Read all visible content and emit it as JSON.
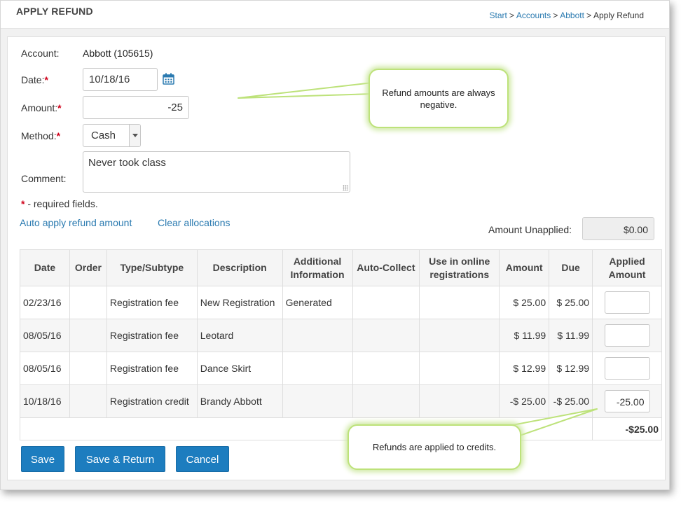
{
  "header": {
    "title": "APPLY REFUND",
    "breadcrumb": [
      "Start",
      "Accounts",
      "Abbott",
      "Apply Refund"
    ],
    "breadcrumb_sep": ">"
  },
  "form": {
    "account_label": "Account:",
    "account_value": "Abbott (105615)",
    "date_label": "Date:",
    "date_value": "10/18/16",
    "amount_label": "Amount:",
    "amount_value": "-25",
    "method_label": "Method:",
    "method_value": "Cash",
    "comment_label": "Comment:",
    "comment_value": "Never took class",
    "required_star": "*",
    "required_note": " - required fields."
  },
  "links": {
    "auto_apply": "Auto apply refund amount",
    "clear": "Clear allocations"
  },
  "unapplied": {
    "label": "Amount Unapplied:",
    "value": "$0.00"
  },
  "table": {
    "headers": [
      "Date",
      "Order",
      "Type/Subtype",
      "Description",
      "Additional Information",
      "Auto-Collect",
      "Use in online registrations",
      "Amount",
      "Due",
      "Applied Amount"
    ],
    "rows": [
      {
        "date": "02/23/16",
        "order": "",
        "type": "Registration fee",
        "description": "New Registration",
        "additional": "Generated",
        "auto_collect": "",
        "online": "",
        "amount": "$ 25.00",
        "due": "$ 25.00",
        "applied": ""
      },
      {
        "date": "08/05/16",
        "order": "",
        "type": "Registration fee",
        "description": "Leotard",
        "additional": "",
        "auto_collect": "",
        "online": "",
        "amount": "$ 11.99",
        "due": "$ 11.99",
        "applied": ""
      },
      {
        "date": "08/05/16",
        "order": "",
        "type": "Registration fee",
        "description": "Dance Skirt",
        "additional": "",
        "auto_collect": "",
        "online": "",
        "amount": "$ 12.99",
        "due": "$ 12.99",
        "applied": ""
      },
      {
        "date": "10/18/16",
        "order": "",
        "type": "Registration credit",
        "description": "Brandy Abbott",
        "additional": "",
        "auto_collect": "",
        "online": "",
        "amount": "-$ 25.00",
        "due": "-$ 25.00",
        "applied": "-25.00"
      }
    ],
    "total": "-$25.00"
  },
  "buttons": {
    "save": "Save",
    "save_return": "Save & Return",
    "cancel": "Cancel"
  },
  "callouts": {
    "top": "Refund amounts are always negative.",
    "bottom": "Refunds are applied to credits."
  },
  "colors": {
    "accent": "#1d7dbf",
    "link": "#2a7ab0",
    "required": "#d0021b",
    "callout_border": "#bde27a"
  }
}
